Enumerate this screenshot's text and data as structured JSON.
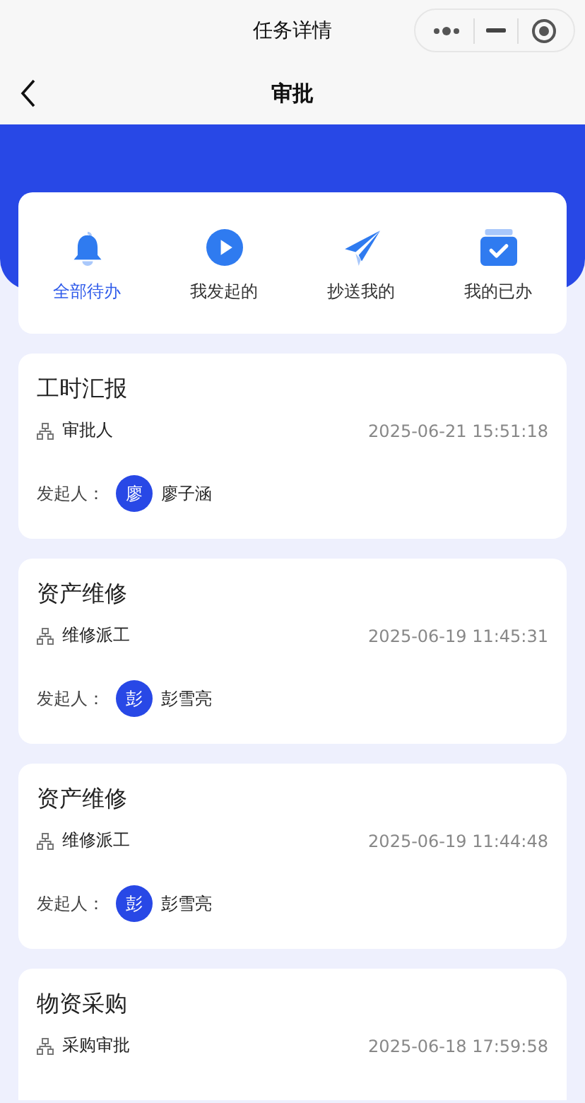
{
  "window": {
    "title": "任务详情"
  },
  "nav": {
    "title": "审批"
  },
  "tabs": [
    {
      "label": "全部待办",
      "selected": true
    },
    {
      "label": "我发起的",
      "selected": false
    },
    {
      "label": "抄送我的",
      "selected": false
    },
    {
      "label": "我的已办",
      "selected": false
    }
  ],
  "tasks": [
    {
      "title": "工时汇报",
      "node": "审批人",
      "time": "2025-06-21 15:51:18",
      "initiator_label": "发起人：",
      "avatar": "廖",
      "initiator": "廖子涵"
    },
    {
      "title": "资产维修",
      "node": "维修派工",
      "time": "2025-06-19 11:45:31",
      "initiator_label": "发起人：",
      "avatar": "彭",
      "initiator": "彭雪亮"
    },
    {
      "title": "资产维修",
      "node": "维修派工",
      "time": "2025-06-19 11:44:48",
      "initiator_label": "发起人：",
      "avatar": "彭",
      "initiator": "彭雪亮"
    },
    {
      "title": "物资采购",
      "node": "采购审批",
      "time": "2025-06-18 17:59:58"
    }
  ]
}
